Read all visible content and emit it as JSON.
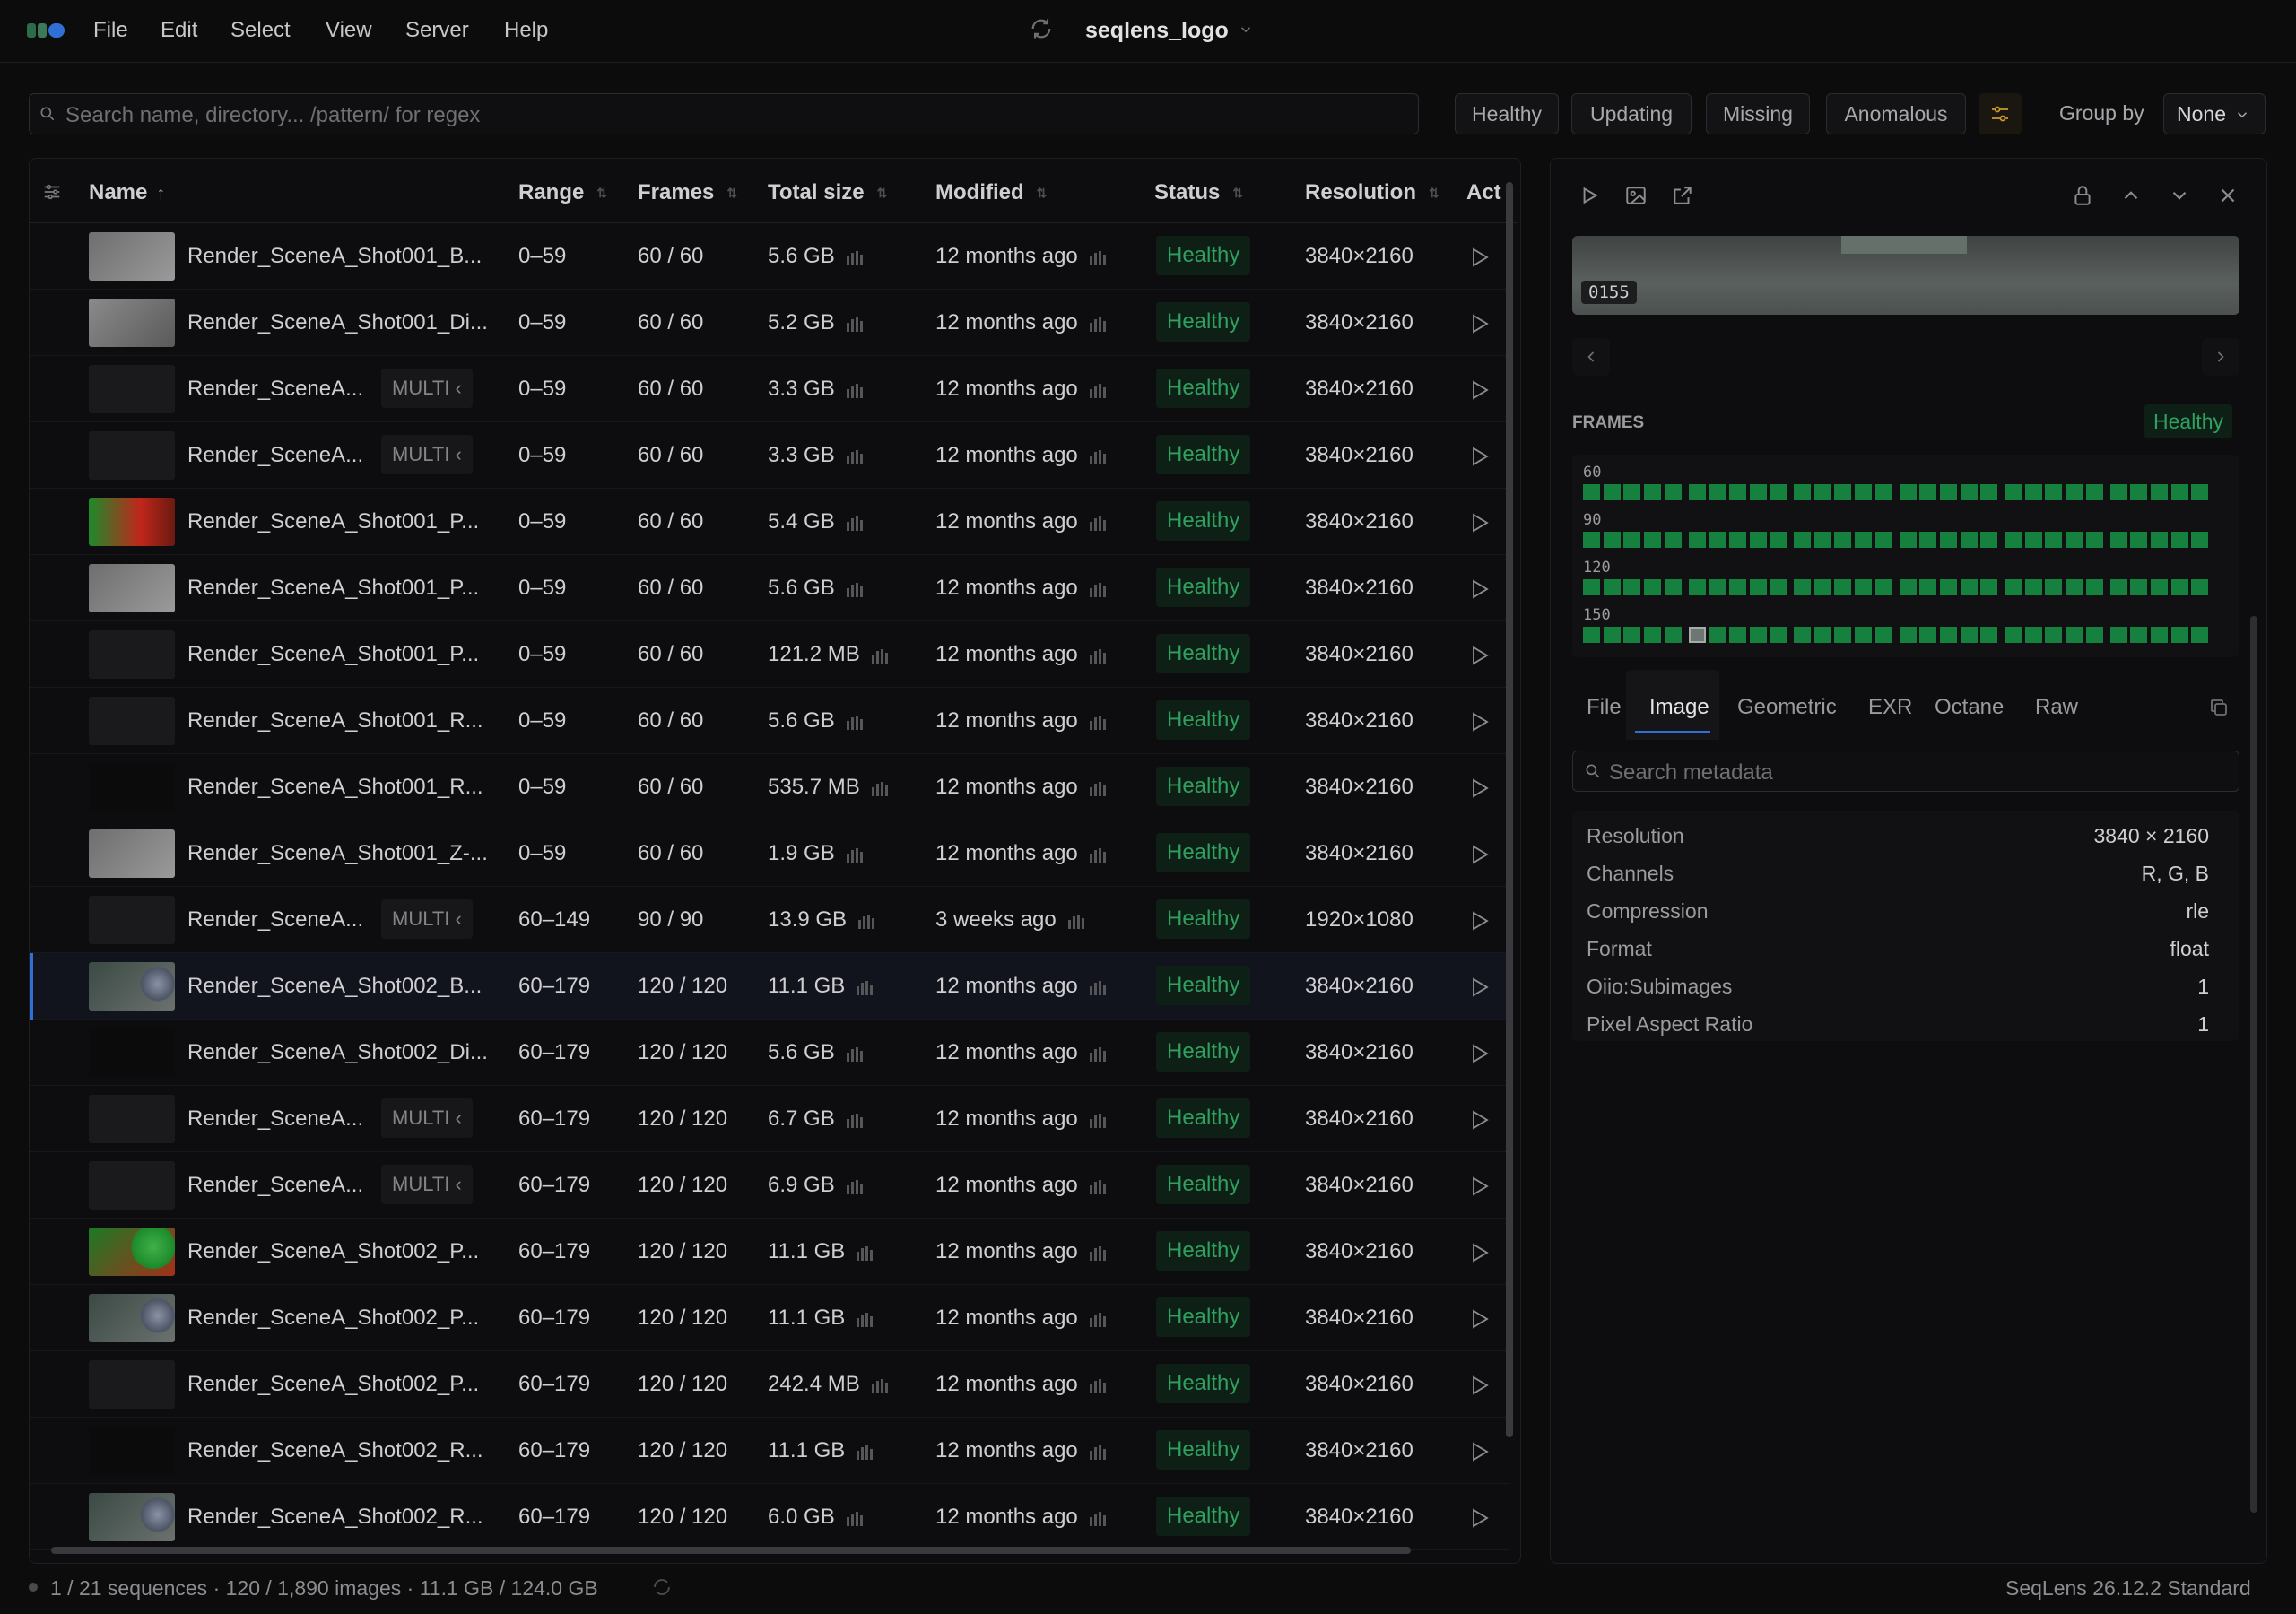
{
  "app": {
    "title": "seqlens_logo",
    "version": "SeqLens 26.12.2 Standard"
  },
  "menu": [
    "File",
    "Edit",
    "Select",
    "View",
    "Server",
    "Help"
  ],
  "search": {
    "placeholder": "Search name, directory... /pattern/ for regex"
  },
  "filters": [
    "Healthy",
    "Updating",
    "Missing",
    "Anomalous"
  ],
  "group_by": {
    "label": "Group by",
    "value": "None"
  },
  "table": {
    "columns": {
      "name": "Name",
      "range": "Range",
      "frames": "Frames",
      "size": "Total size",
      "modified": "Modified",
      "status": "Status",
      "resolution": "Resolution",
      "actions": "Act"
    },
    "multi_label": "MULTI",
    "rows": [
      {
        "name": "Render_SceneA_Shot001_B...",
        "multi": false,
        "range": "0–59",
        "frames": "60 / 60",
        "size": "5.6 GB",
        "modified": "12 months ago",
        "status": "Healthy",
        "resolution": "3840×2160",
        "thumb": "grey"
      },
      {
        "name": "Render_SceneA_Shot001_Di...",
        "multi": false,
        "range": "0–59",
        "frames": "60 / 60",
        "size": "5.2 GB",
        "modified": "12 months ago",
        "status": "Healthy",
        "resolution": "3840×2160",
        "thumb": "grey-dark"
      },
      {
        "name": "Render_SceneA...",
        "multi": true,
        "range": "0–59",
        "frames": "60 / 60",
        "size": "3.3 GB",
        "modified": "12 months ago",
        "status": "Healthy",
        "resolution": "3840×2160",
        "thumb": "empty"
      },
      {
        "name": "Render_SceneA...",
        "multi": true,
        "range": "0–59",
        "frames": "60 / 60",
        "size": "3.3 GB",
        "modified": "12 months ago",
        "status": "Healthy",
        "resolution": "3840×2160",
        "thumb": "empty"
      },
      {
        "name": "Render_SceneA_Shot001_P...",
        "multi": false,
        "range": "0–59",
        "frames": "60 / 60",
        "size": "5.4 GB",
        "modified": "12 months ago",
        "status": "Healthy",
        "resolution": "3840×2160",
        "thumb": "rgb"
      },
      {
        "name": "Render_SceneA_Shot001_P...",
        "multi": false,
        "range": "0–59",
        "frames": "60 / 60",
        "size": "5.6 GB",
        "modified": "12 months ago",
        "status": "Healthy",
        "resolution": "3840×2160",
        "thumb": "grey"
      },
      {
        "name": "Render_SceneA_Shot001_P...",
        "multi": false,
        "range": "0–59",
        "frames": "60 / 60",
        "size": "121.2 MB",
        "modified": "12 months ago",
        "status": "Healthy",
        "resolution": "3840×2160",
        "thumb": "empty"
      },
      {
        "name": "Render_SceneA_Shot001_R...",
        "multi": false,
        "range": "0–59",
        "frames": "60 / 60",
        "size": "5.6 GB",
        "modified": "12 months ago",
        "status": "Healthy",
        "resolution": "3840×2160",
        "thumb": "empty"
      },
      {
        "name": "Render_SceneA_Shot001_R...",
        "multi": false,
        "range": "0–59",
        "frames": "60 / 60",
        "size": "535.7 MB",
        "modified": "12 months ago",
        "status": "Healthy",
        "resolution": "3840×2160",
        "thumb": "black"
      },
      {
        "name": "Render_SceneA_Shot001_Z-...",
        "multi": false,
        "range": "0–59",
        "frames": "60 / 60",
        "size": "1.9 GB",
        "modified": "12 months ago",
        "status": "Healthy",
        "resolution": "3840×2160",
        "thumb": "grey"
      },
      {
        "name": "Render_SceneA...",
        "multi": true,
        "range": "60–149",
        "frames": "90 / 90",
        "size": "13.9 GB",
        "modified": "3 weeks ago",
        "status": "Healthy",
        "resolution": "1920×1080",
        "thumb": "empty"
      },
      {
        "name": "Render_SceneA_Shot002_B...",
        "multi": false,
        "range": "60–179",
        "frames": "120 / 120",
        "size": "11.1 GB",
        "modified": "12 months ago",
        "status": "Healthy",
        "resolution": "3840×2160",
        "thumb": "spheres",
        "selected": true
      },
      {
        "name": "Render_SceneA_Shot002_Di...",
        "multi": false,
        "range": "60–179",
        "frames": "120 / 120",
        "size": "5.6 GB",
        "modified": "12 months ago",
        "status": "Healthy",
        "resolution": "3840×2160",
        "thumb": "black"
      },
      {
        "name": "Render_SceneA...",
        "multi": true,
        "range": "60–179",
        "frames": "120 / 120",
        "size": "6.7 GB",
        "modified": "12 months ago",
        "status": "Healthy",
        "resolution": "3840×2160",
        "thumb": "empty"
      },
      {
        "name": "Render_SceneA...",
        "multi": true,
        "range": "60–179",
        "frames": "120 / 120",
        "size": "6.9 GB",
        "modified": "12 months ago",
        "status": "Healthy",
        "resolution": "3840×2160",
        "thumb": "empty"
      },
      {
        "name": "Render_SceneA_Shot002_P...",
        "multi": false,
        "range": "60–179",
        "frames": "120 / 120",
        "size": "11.1 GB",
        "modified": "12 months ago",
        "status": "Healthy",
        "resolution": "3840×2160",
        "thumb": "green"
      },
      {
        "name": "Render_SceneA_Shot002_P...",
        "multi": false,
        "range": "60–179",
        "frames": "120 / 120",
        "size": "11.1 GB",
        "modified": "12 months ago",
        "status": "Healthy",
        "resolution": "3840×2160",
        "thumb": "spheres"
      },
      {
        "name": "Render_SceneA_Shot002_P...",
        "multi": false,
        "range": "60–179",
        "frames": "120 / 120",
        "size": "242.4 MB",
        "modified": "12 months ago",
        "status": "Healthy",
        "resolution": "3840×2160",
        "thumb": "empty"
      },
      {
        "name": "Render_SceneA_Shot002_R...",
        "multi": false,
        "range": "60–179",
        "frames": "120 / 120",
        "size": "11.1 GB",
        "modified": "12 months ago",
        "status": "Healthy",
        "resolution": "3840×2160",
        "thumb": "black"
      },
      {
        "name": "Render_SceneA_Shot002_R...",
        "multi": false,
        "range": "60–179",
        "frames": "120 / 120",
        "size": "6.0 GB",
        "modified": "12 months ago",
        "status": "Healthy",
        "resolution": "3840×2160",
        "thumb": "spheres"
      }
    ]
  },
  "inspector": {
    "current_frame": "0155",
    "frames_title": "FRAMES",
    "frames_status": "Healthy",
    "frame_rows": [
      {
        "label": "60",
        "count": 30
      },
      {
        "label": "90",
        "count": 30
      },
      {
        "label": "120",
        "count": 30
      },
      {
        "label": "150",
        "count": 30,
        "current_index": 5
      }
    ],
    "tabs": [
      "File",
      "Image",
      "Geometric",
      "EXR",
      "Octane",
      "Raw"
    ],
    "active_tab": "Image",
    "meta_search_placeholder": "Search metadata",
    "metadata": [
      {
        "key": "Resolution",
        "value": "3840 × 2160"
      },
      {
        "key": "Channels",
        "value": "R, G, B"
      },
      {
        "key": "Compression",
        "value": "rle"
      },
      {
        "key": "Format",
        "value": "float"
      },
      {
        "key": "Oiio:Subimages",
        "value": "1"
      },
      {
        "key": "Pixel Aspect Ratio",
        "value": "1"
      }
    ]
  },
  "status_bar": {
    "summary": "1 / 21 sequences · 120 / 1,890 images · 11.1 GB / 124.0 GB"
  },
  "colors": {
    "accent": "#2f6fd6",
    "healthy": "#2fa060",
    "frame_ok": "#16803f",
    "background": "#0c0c0d"
  }
}
